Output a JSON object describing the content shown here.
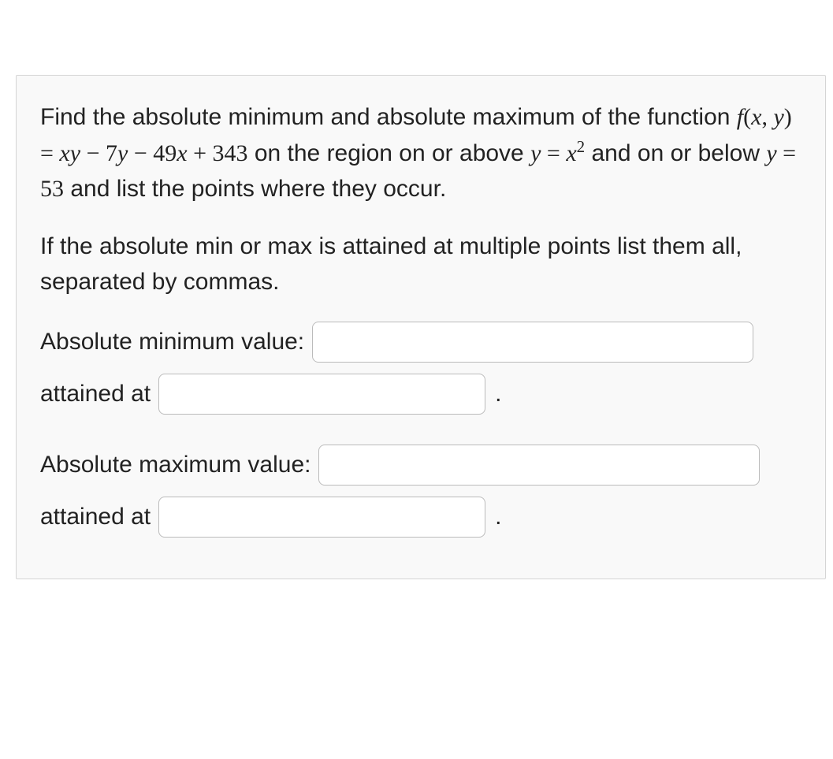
{
  "question": {
    "p1_part1": "Find the absolute minimum and absolute maximum of the function ",
    "fxy": "f(x, y) = xy − 7y − 49x + 343",
    "p1_part2": " on the region on or above ",
    "eq1_lhs": "y = ",
    "eq1_rhs_var": "x",
    "eq1_rhs_exp": "2",
    "p1_part3": " and on or below ",
    "eq2": "y = 53",
    "p1_part4": " and list the points where they occur.",
    "p2": "If the absolute min or max is attained at multiple points list them all, separated by commas."
  },
  "answers": {
    "min_label": "Absolute minimum value:",
    "min_attained_label": "attained at",
    "max_label": "Absolute maximum value:",
    "max_attained_label": "attained at",
    "period": "."
  },
  "inputs": {
    "min_value": "",
    "min_at": "",
    "max_value": "",
    "max_at": ""
  }
}
